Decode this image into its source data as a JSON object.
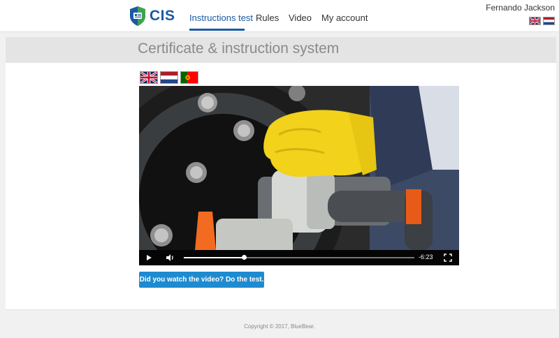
{
  "header": {
    "logo_text": "CIS",
    "nav": [
      "Instructions test",
      "Rules",
      "Video",
      "My account"
    ],
    "active_nav": "Instructions test",
    "user_name": "Fernando Jackson",
    "header_flags": [
      "uk-flag-icon",
      "nl-flag-icon"
    ]
  },
  "banner": {
    "title": "Certificate & instruction system"
  },
  "languages": [
    "uk-flag-icon",
    "nl-flag-icon",
    "pt-flag-icon"
  ],
  "video": {
    "time_remaining": "-6:23",
    "progress": 0.26,
    "controls": [
      "play-icon",
      "volume-icon",
      "fullscreen-icon"
    ]
  },
  "cta": {
    "label": "Did you watch the video? Do the test."
  },
  "footer": {
    "copyright": "Copyright © 2017, BlueBear."
  },
  "colors": {
    "accent": "#1a5aa3",
    "button": "#1e8bd1",
    "banner_bg": "#e4e4e4"
  }
}
